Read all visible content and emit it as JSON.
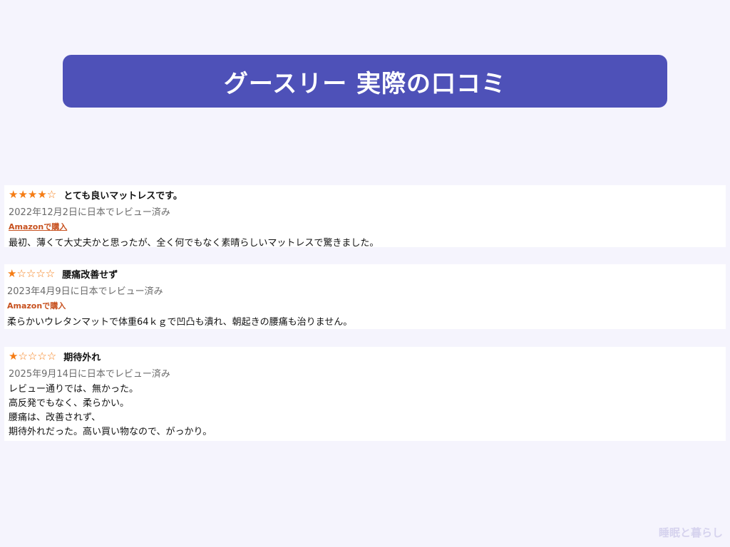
{
  "banner": {
    "title": "グースリー 実際の口コミ"
  },
  "colors": {
    "banner": "#4e51b8",
    "star": "#f57c14",
    "verified": "#c7511f",
    "background": "#f5f4fd"
  },
  "reviews": [
    {
      "rating": 4,
      "stars": "★★★★☆",
      "title": "とても良いマットレスです。",
      "date": "2022年12月2日に日本でレビュー済み",
      "verified": "Amazonで購入",
      "body": [
        "最初、薄くて大丈夫かと思ったが、全く何でもなく素晴らしいマットレスで驚きました。"
      ]
    },
    {
      "rating": 1,
      "stars": "★☆☆☆☆",
      "title": "腰痛改善せず",
      "date": "2023年4月9日に日本でレビュー済み",
      "verified": "Amazonで購入",
      "body": [
        "柔らかいウレタンマットで体重64ｋｇで凹凸も潰れ、朝起きの腰痛も治りません。"
      ]
    },
    {
      "rating": 1,
      "stars": "★☆☆☆☆",
      "title": "期待外れ",
      "date": "2025年9月14日に日本でレビュー済み",
      "body": [
        "レビュー通りでは、無かった。",
        "高反発でもなく、柔らかい。",
        "腰痛は、改善されず、",
        "期待外れだった。高い買い物なので、がっかり。"
      ]
    }
  ],
  "watermark": "睡眠と暮らし"
}
